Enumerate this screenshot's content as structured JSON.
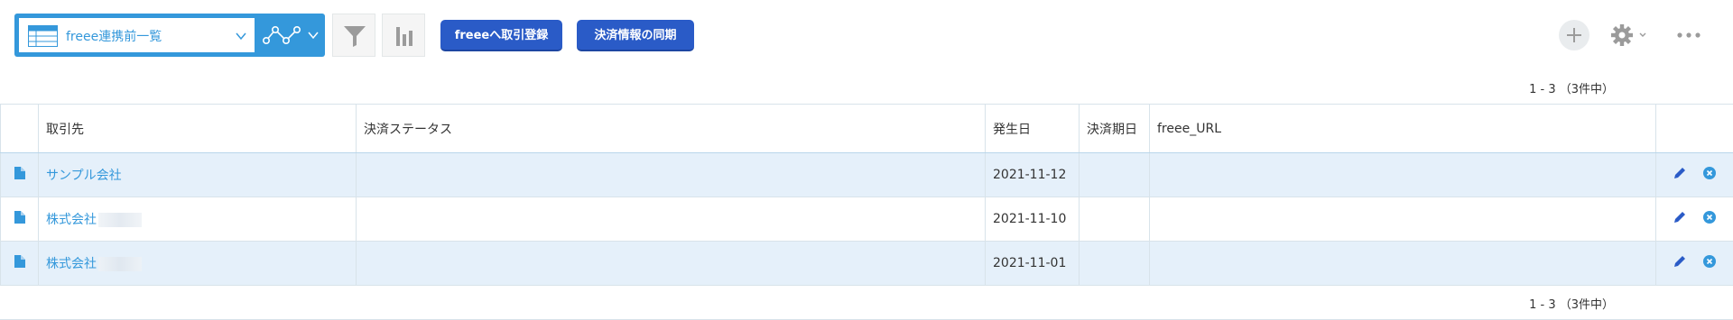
{
  "toolbar": {
    "view_name": "freee連携前一覧",
    "buttons": {
      "freee_register": "freeeへ取引登録",
      "sync_payment": "決済情報の同期"
    }
  },
  "pager": {
    "range_text": "1 - 3 （3件中）"
  },
  "table": {
    "headers": [
      "取引先",
      "決済ステータス",
      "発生日",
      "決済期日",
      "freee_URL"
    ],
    "rows": [
      {
        "client": "サンプル会社",
        "status": "",
        "date": "2021-11-12",
        "due": "",
        "url": ""
      },
      {
        "client": "株式会社",
        "status": "",
        "date": "2021-11-10",
        "due": "",
        "url": ""
      },
      {
        "client": "株式会社",
        "status": "",
        "date": "2021-11-01",
        "due": "",
        "url": ""
      }
    ]
  },
  "colors": {
    "accent": "#3498db",
    "button_blue": "#2a5bc7",
    "row_highlight": "#e5f0fa"
  },
  "icons": [
    "table-icon",
    "chevron-down-icon",
    "graph-icon",
    "filter-icon",
    "bar-chart-icon",
    "plus-icon",
    "gear-icon",
    "more-icon",
    "document-icon",
    "pencil-icon",
    "delete-icon"
  ]
}
